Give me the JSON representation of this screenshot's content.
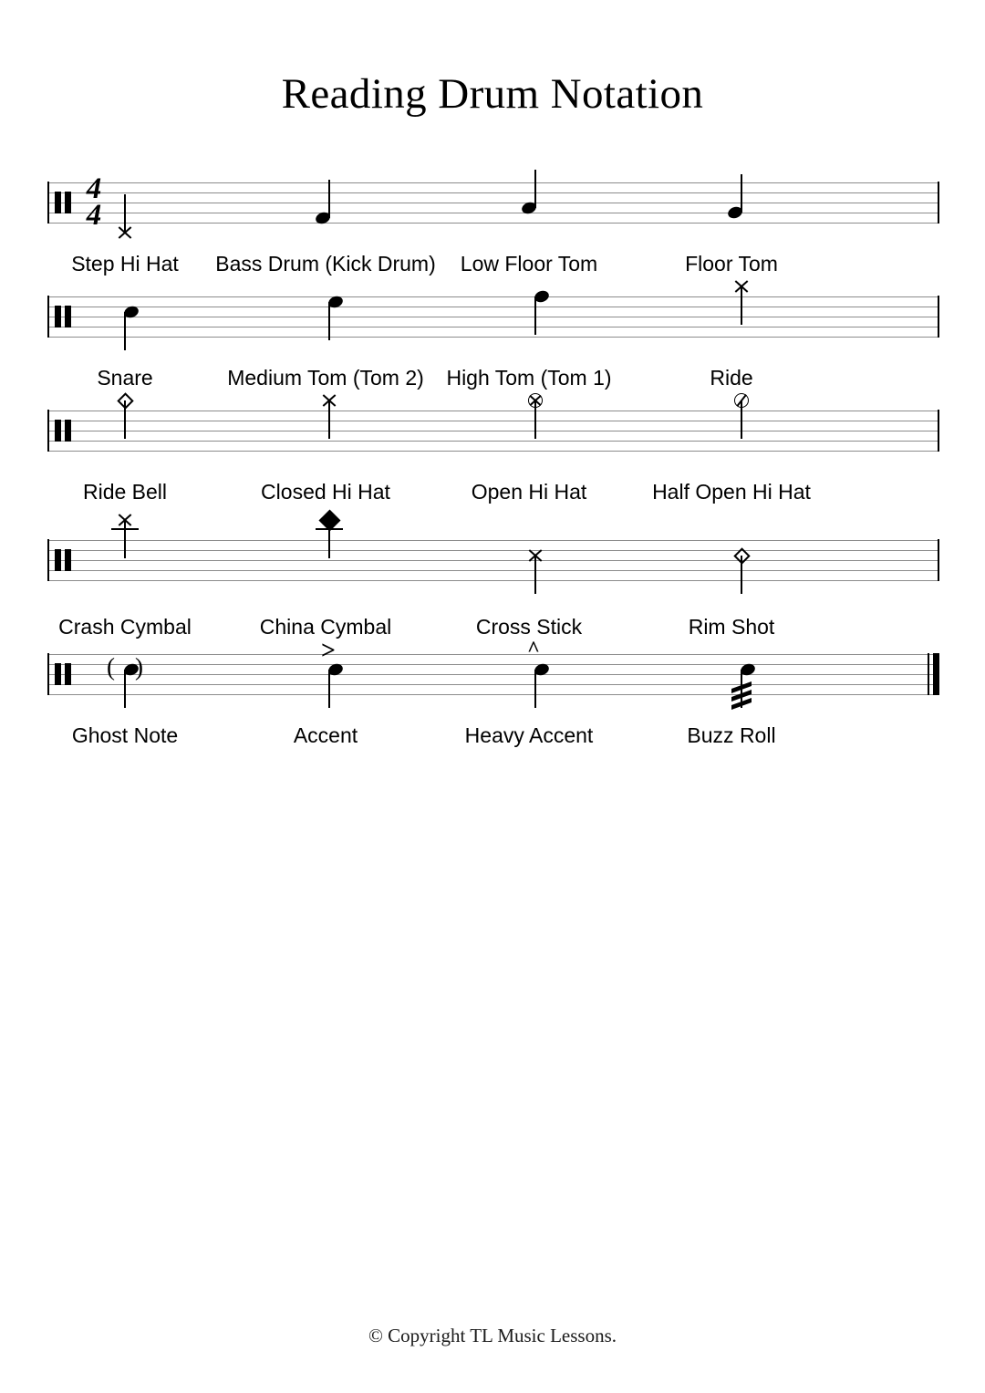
{
  "title": "Reading Drum Notation",
  "footer": "© Copyright TL Music Lessons.",
  "time_signature": {
    "numerator": "4",
    "denominator": "4"
  },
  "colors": {
    "ink": "#000000",
    "staff_line": "#8c8c8c",
    "background": "#ffffff"
  },
  "systems": [
    {
      "index": 1,
      "has_time_signature": true,
      "final_barline": false,
      "notes": [
        {
          "label": "Step Hi Hat",
          "notehead": "x",
          "stem": "up",
          "position": "below-staff",
          "articulation": "",
          "ghost": false,
          "ledger": false
        },
        {
          "label": "Bass Drum (Kick Drum)",
          "notehead": "filled",
          "stem": "up",
          "position": "bottom-space",
          "articulation": "",
          "ghost": false,
          "ledger": false
        },
        {
          "label": "Low Floor Tom",
          "notehead": "filled",
          "stem": "up",
          "position": "space-2",
          "articulation": "",
          "ghost": false,
          "ledger": false
        },
        {
          "label": "Floor Tom",
          "notehead": "filled",
          "stem": "up",
          "position": "line-2",
          "articulation": "",
          "ghost": false,
          "ledger": false
        }
      ]
    },
    {
      "index": 2,
      "has_time_signature": false,
      "final_barline": false,
      "notes": [
        {
          "label": "Snare",
          "notehead": "filled",
          "stem": "down",
          "position": "space-3",
          "articulation": "",
          "ghost": false,
          "ledger": false
        },
        {
          "label": "Medium Tom (Tom 2)",
          "notehead": "filled",
          "stem": "down",
          "position": "space-4",
          "articulation": "",
          "ghost": false,
          "ledger": false
        },
        {
          "label": "High Tom (Tom 1)",
          "notehead": "filled",
          "stem": "down",
          "position": "line-5",
          "articulation": "",
          "ghost": false,
          "ledger": false
        },
        {
          "label": "Ride",
          "notehead": "x",
          "stem": "down",
          "position": "above-staff",
          "articulation": "",
          "ghost": false,
          "ledger": false
        }
      ]
    },
    {
      "index": 3,
      "has_time_signature": false,
      "final_barline": false,
      "notes": [
        {
          "label": "Ride Bell",
          "notehead": "diamond",
          "stem": "down",
          "position": "above-staff",
          "articulation": "",
          "ghost": false,
          "ledger": false
        },
        {
          "label": "Closed Hi Hat",
          "notehead": "x",
          "stem": "down",
          "position": "above-staff",
          "articulation": "",
          "ghost": false,
          "ledger": false
        },
        {
          "label": "Open Hi Hat",
          "notehead": "circle-x",
          "stem": "down",
          "position": "above-staff",
          "articulation": "",
          "ghost": false,
          "ledger": false
        },
        {
          "label": "Half Open Hi Hat",
          "notehead": "circle-slash",
          "stem": "down",
          "position": "above-staff",
          "articulation": "",
          "ghost": false,
          "ledger": false
        }
      ]
    },
    {
      "index": 4,
      "has_time_signature": false,
      "final_barline": false,
      "notes": [
        {
          "label": "Crash Cymbal",
          "notehead": "x",
          "stem": "down",
          "position": "ledger-above",
          "articulation": "",
          "ghost": false,
          "ledger": true
        },
        {
          "label": "China Cymbal",
          "notehead": "diamond-filled-x",
          "stem": "down",
          "position": "ledger-above",
          "articulation": "",
          "ghost": false,
          "ledger": true
        },
        {
          "label": "Cross Stick",
          "notehead": "x",
          "stem": "down",
          "position": "space-3",
          "articulation": "",
          "ghost": false,
          "ledger": false
        },
        {
          "label": "Rim Shot",
          "notehead": "diamond",
          "stem": "down",
          "position": "space-3",
          "articulation": "",
          "ghost": false,
          "ledger": false
        }
      ]
    },
    {
      "index": 5,
      "has_time_signature": false,
      "final_barline": true,
      "notes": [
        {
          "label": "Ghost Note",
          "notehead": "filled",
          "stem": "down",
          "position": "space-3",
          "articulation": "",
          "ghost": true,
          "ledger": false
        },
        {
          "label": "Accent",
          "notehead": "filled",
          "stem": "down",
          "position": "space-3",
          "articulation": ">",
          "ghost": false,
          "ledger": false
        },
        {
          "label": "Heavy Accent",
          "notehead": "filled",
          "stem": "down",
          "position": "space-3",
          "articulation": "^",
          "ghost": false,
          "ledger": false
        },
        {
          "label": "Buzz Roll",
          "notehead": "filled",
          "stem": "down",
          "position": "space-3",
          "articulation": "",
          "ghost": false,
          "ledger": false,
          "tremolo_slashes": 3
        }
      ]
    }
  ]
}
